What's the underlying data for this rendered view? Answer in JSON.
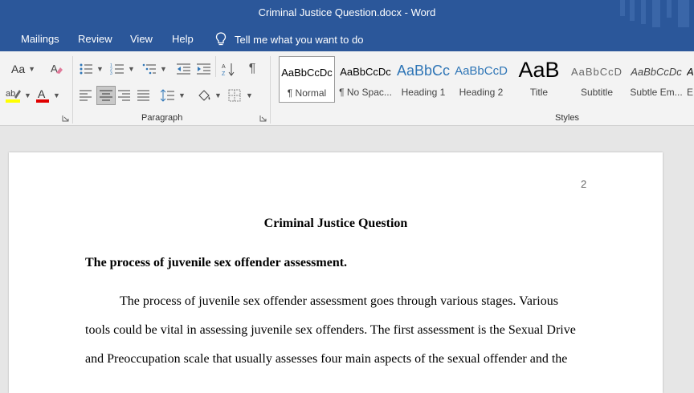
{
  "window": {
    "title": "Criminal Justice Question.docx  -  Word"
  },
  "tabs": [
    "Mailings",
    "Review",
    "View",
    "Help"
  ],
  "tell_me": "Tell me what you want to do",
  "ribbon": {
    "font_size_label": "Aa",
    "paragraph_label": "Paragraph",
    "styles_label": "Styles",
    "styles": [
      {
        "preview": "AaBbCcDc",
        "name": "¶ Normal"
      },
      {
        "preview": "AaBbCcDc",
        "name": "¶ No Spac..."
      },
      {
        "preview": "AaBbCc",
        "name": "Heading 1"
      },
      {
        "preview": "AaBbCcD",
        "name": "Heading 2"
      },
      {
        "preview": "AaB",
        "name": "Title"
      },
      {
        "preview": "AaBbCcD",
        "name": "Subtitle"
      },
      {
        "preview": "AaBbCcDc",
        "name": "Subtle Em..."
      },
      {
        "preview": "A",
        "name": "E"
      }
    ],
    "colors": {
      "highlight": "#ffff00",
      "font_color": "#e00000"
    }
  },
  "document": {
    "page_number": "2",
    "title": "Criminal Justice Question",
    "heading": "The process of juvenile sex offender assessment.",
    "lines": [
      "The process of juvenile sex offender assessment goes through various stages. Various",
      "tools could be vital in assessing juvenile sex offenders. The first assessment is the Sexual Drive",
      "and Preoccupation scale that usually assesses four main aspects of the sexual offender and the"
    ]
  },
  "theme": {
    "titlebar": "#2b579a",
    "accent_blue": "#2e75b6"
  }
}
